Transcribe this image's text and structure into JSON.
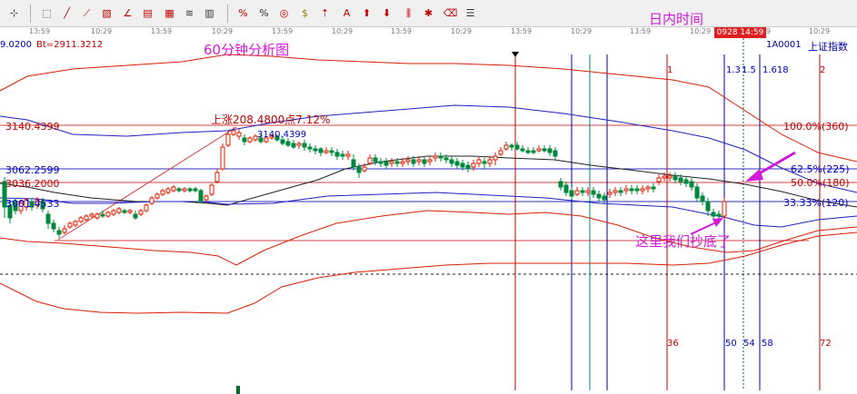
{
  "toolbar": {
    "title": "日内时间",
    "buttons": [
      {
        "name": "crosshair-icon",
        "glyph": "⊹"
      },
      {
        "name": "line-select-icon",
        "glyph": "⬚"
      },
      {
        "name": "trendline-icon",
        "glyph": "╱"
      },
      {
        "name": "fan-lines-icon",
        "glyph": "⟋"
      },
      {
        "name": "parallel-lines-icon",
        "glyph": "▧"
      },
      {
        "name": "angle-line-icon",
        "glyph": "∠"
      },
      {
        "name": "rectangle-icon",
        "glyph": "▤"
      },
      {
        "name": "grid-lines-icon",
        "glyph": "▦"
      },
      {
        "name": "arc-icon",
        "glyph": "≋"
      },
      {
        "name": "golden-section-icon",
        "glyph": "▥"
      },
      {
        "name": "fibonacci-icon",
        "glyph": "%"
      },
      {
        "name": "percent-icon",
        "glyph": "%"
      },
      {
        "name": "circle-icon",
        "glyph": "◎"
      },
      {
        "name": "dollar-icon",
        "glyph": "$"
      },
      {
        "name": "arrow-tool-icon",
        "glyph": "⇡"
      },
      {
        "name": "text-label-icon",
        "glyph": "A"
      },
      {
        "name": "up-arrow-icon",
        "glyph": "⬆"
      },
      {
        "name": "down-arrow-icon",
        "glyph": "⬇"
      },
      {
        "name": "cycle-icon",
        "glyph": "⫼"
      },
      {
        "name": "star-icon",
        "glyph": "✱"
      },
      {
        "name": "erase-icon",
        "glyph": "⌫"
      },
      {
        "name": "settings-icon",
        "glyph": "☰"
      }
    ]
  },
  "time_axis": {
    "labels": [
      "13:59",
      "10:29",
      "13:59",
      "10:29",
      "13:59",
      "10:29",
      "13:59",
      "10:29",
      "13:59",
      "10:29",
      "13:59",
      "10:29",
      "13:59",
      "10:29"
    ],
    "current_time": "0928 14:59"
  },
  "info": {
    "left_value": "9.0200",
    "bt_value": "Bt=2911.3212",
    "code": "1A0001",
    "index_name": "上证指数"
  },
  "annotations": {
    "chart_title": "60分钟分析图",
    "rise_label": "上涨208.4800点7.12%",
    "bottom_note": "这里我们抄底了",
    "peak_value": "3140.4399"
  },
  "price_levels": [
    {
      "label": "3140.4399",
      "color": "#c00000"
    },
    {
      "label": "3062.2599",
      "color": "#0000c0"
    },
    {
      "label": "3036.2000",
      "color": "#c00000"
    },
    {
      "label": "3001.4533",
      "color": "#0000c0"
    }
  ],
  "fib_levels": [
    {
      "label": "100.0%(360)",
      "color": "#c00000"
    },
    {
      "label": "62.5%(225)",
      "color": "#0000c0"
    },
    {
      "label": "50.0%(180)",
      "color": "#c00000"
    },
    {
      "label": "33.33%(120)",
      "color": "#0000c0"
    }
  ],
  "cycle_labels": {
    "top": [
      "1",
      "1.3",
      "1.5",
      "1.618",
      "2"
    ],
    "bottom": [
      "36",
      "50",
      "54",
      "58",
      "72"
    ]
  },
  "colors": {
    "rise": "#d81e06",
    "fall": "#00893e",
    "band": "#d81e06",
    "midband": "#2020c0",
    "annotation": "#d11ad9"
  }
}
